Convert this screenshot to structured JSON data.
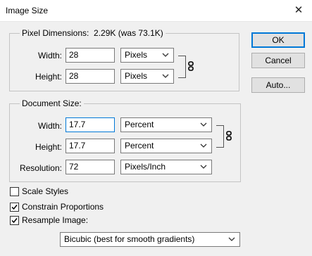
{
  "window": {
    "title": "Image Size",
    "close_glyph": "✕"
  },
  "pixel_dimensions": {
    "label": "Pixel Dimensions:",
    "size": "2.29K (was 73.1K)",
    "width": {
      "label": "Width:",
      "value": "28",
      "unit": "Pixels"
    },
    "height": {
      "label": "Height:",
      "value": "28",
      "unit": "Pixels"
    }
  },
  "document_size": {
    "label": "Document Size:",
    "width": {
      "label": "Width:",
      "value": "17.7",
      "unit": "Percent"
    },
    "height": {
      "label": "Height:",
      "value": "17.7",
      "unit": "Percent"
    },
    "resolution": {
      "label": "Resolution:",
      "value": "72",
      "unit": "Pixels/Inch"
    }
  },
  "options": {
    "scale_styles": {
      "label": "Scale Styles",
      "checked": false
    },
    "constrain_proportions": {
      "label": "Constrain Proportions",
      "checked": true
    },
    "resample_image": {
      "label": "Resample Image:",
      "checked": true
    },
    "resample_method": "Bicubic (best for smooth gradients)"
  },
  "buttons": {
    "ok": "OK",
    "cancel": "Cancel",
    "auto": "Auto..."
  },
  "icons": {
    "link": "chain-link-icon",
    "dropdown": "chevron-down-icon",
    "close": "close-icon",
    "check": "checkmark-icon"
  },
  "colors": {
    "accent": "#0078d7",
    "dialog_bg": "#f0f0f0"
  }
}
